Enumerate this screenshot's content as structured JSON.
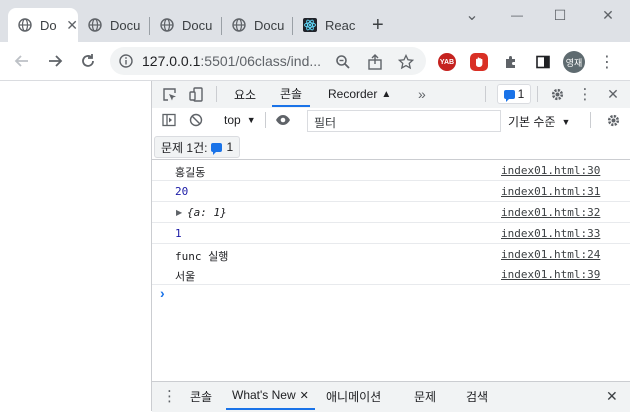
{
  "tabs": [
    {
      "label": "Do",
      "active": true
    },
    {
      "label": "Docu"
    },
    {
      "label": "Docu"
    },
    {
      "label": "Docu"
    },
    {
      "label": "React"
    }
  ],
  "new_tab_icon": "+",
  "window": {
    "minimize": "⌄",
    "restore": "—",
    "max": "☐",
    "close": "✕"
  },
  "address": {
    "host": "127.0.0.1",
    "rest": ":5501/06class/ind..."
  },
  "profile": {
    "initials": "영재"
  },
  "ext": {
    "yab": "YAB"
  },
  "devtools": {
    "tabs": [
      "요소",
      "콘솔",
      "Recorder"
    ],
    "more": "»",
    "issues_count": "1",
    "context": "top",
    "filter_placeholder": "필터",
    "levels": "기본 수준",
    "issues_label": "문제 1건:",
    "issues_badge": "1",
    "console_rows": [
      {
        "text": "홍길동",
        "source": "index01.html:30",
        "kind": "str"
      },
      {
        "text": "20",
        "source": "index01.html:31",
        "kind": "num"
      },
      {
        "text": "{a: 1}",
        "source": "index01.html:32",
        "kind": "obj"
      },
      {
        "text": "1",
        "source": "index01.html:33",
        "kind": "num"
      },
      {
        "text": "func 실행",
        "source": "index01.html:24",
        "kind": "str"
      },
      {
        "text": "서울",
        "source": "index01.html:39",
        "kind": "str"
      }
    ],
    "prompt": "›",
    "drawer_tabs": [
      "콘솔",
      "What's New",
      "애니메이션",
      "문제",
      "검색"
    ],
    "drawer_close": "✕"
  }
}
